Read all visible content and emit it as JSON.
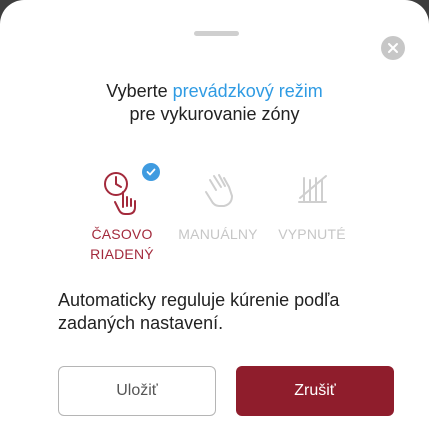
{
  "header": {
    "title_prefix": "Vyberte ",
    "title_highlight": "prevádzkový režim",
    "title_line2": "pre vykurovanie zóny"
  },
  "modes": [
    {
      "line1": "ČASOVO",
      "line2": "RIADENÝ",
      "icon": "clock-hand-icon",
      "selected": true
    },
    {
      "line1": "MANUÁLNY",
      "line2": "",
      "icon": "hand-tap-icon",
      "selected": false
    },
    {
      "line1": "VYPNUTÉ",
      "line2": "",
      "icon": "heating-off-icon",
      "selected": false
    }
  ],
  "description": "Automaticky reguluje kúrenie podľa zadaných nastavení.",
  "buttons": {
    "save_label": "Uložiť",
    "cancel_label": "Zrušiť"
  },
  "colors": {
    "accent": "#a32a3c",
    "highlight": "#2f9be3",
    "cancel_bg": "#8f1d2c",
    "check": "#3f9be0"
  }
}
